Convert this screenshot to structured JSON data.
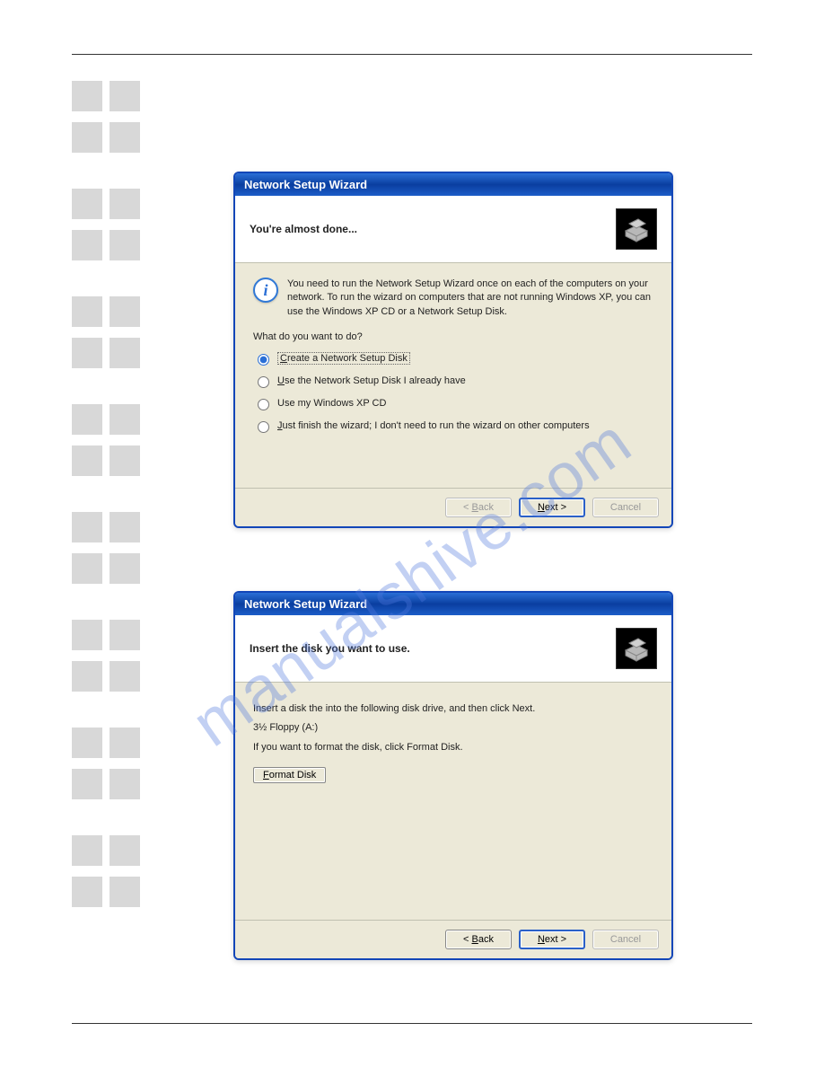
{
  "watermark": "manualshive.com",
  "dialog1": {
    "title": "Network Setup Wizard",
    "heading": "You're almost done...",
    "info_text": "You need to run the Network Setup Wizard once on each of the computers on your network. To run the wizard on computers that are not running Windows XP, you can use the Windows XP CD or a Network Setup Disk.",
    "question": "What do you want to do?",
    "options": {
      "o1_pre": "C",
      "o1_rest": "reate a Network Setup Disk",
      "o2_pre": "U",
      "o2_rest": "se the Network Setup Disk I already have",
      "o3": "Use my Windows XP CD",
      "o4_pre": "J",
      "o4_rest": "ust finish the wizard; I don't need to run the wizard on other computers"
    },
    "buttons": {
      "back_pre": "< ",
      "back_u": "B",
      "back_rest": "ack",
      "next_u": "N",
      "next_rest": "ext >",
      "cancel": "Cancel"
    }
  },
  "dialog2": {
    "title": "Network Setup Wizard",
    "heading": "Insert the disk you want to use.",
    "line1": "Insert a disk the into the following disk drive, and then click Next.",
    "drive": "3½ Floppy (A:)",
    "line2": "If you want to format the disk, click Format Disk.",
    "format_u": "F",
    "format_rest": "ormat Disk",
    "buttons": {
      "back_pre": "< ",
      "back_u": "B",
      "back_rest": "ack",
      "next_u": "N",
      "next_rest": "ext >",
      "cancel": "Cancel"
    }
  }
}
